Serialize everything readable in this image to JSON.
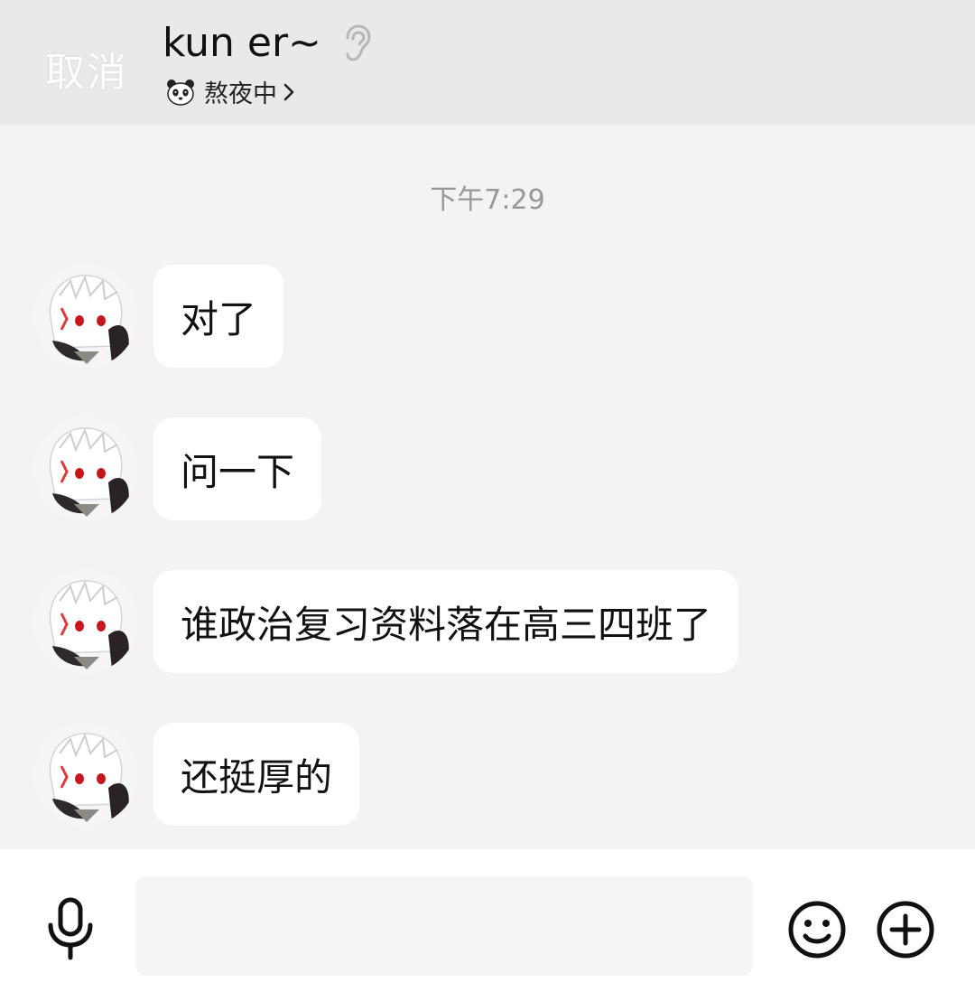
{
  "header": {
    "cancel_label": "取消",
    "contact_name": "kun er~",
    "status_text": "熬夜中",
    "icons": {
      "ear": "ear-icon",
      "status": "panda-icon",
      "chevron": "chevron-right-icon"
    }
  },
  "chat": {
    "timestamp": "下午7:29",
    "messages": [
      {
        "text": "对了"
      },
      {
        "text": "问一下"
      },
      {
        "text": "谁政治复习资料落在高三四班了"
      },
      {
        "text": "还挺厚的"
      }
    ]
  },
  "input_bar": {
    "input_value": "",
    "placeholder": "",
    "icons": {
      "voice": "microphone-icon",
      "emoji": "smiley-icon",
      "more": "plus-circle-icon"
    }
  },
  "colors": {
    "header_bg": "#ebe8ec",
    "chat_bg": "#f4f2f5",
    "bubble_bg": "#ffffff",
    "timestamp_text": "#9a979c"
  }
}
